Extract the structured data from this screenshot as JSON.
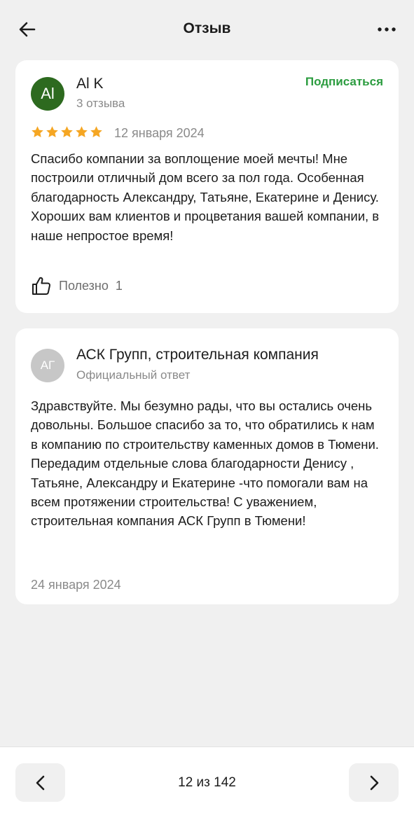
{
  "header": {
    "title": "Отзыв",
    "back_icon": "arrow-left-icon",
    "more_icon": "more-horizontal-icon"
  },
  "review": {
    "avatar_initials": "Al",
    "avatar_color": "#2d6a1f",
    "author": "Al K",
    "author_meta": "3 отзыва",
    "subscribe_label": "Подписаться",
    "subscribe_color": "#2b9c3f",
    "rating": 5,
    "rating_max": 5,
    "star_color": "#f5a623",
    "date": "12 января 2024",
    "text": "Спасибо компании за воплощение моей мечты! Мне построили отличный дом всего за пол года. Особенная благодарность Александру, Татьяне, Екатерине и Денису. Хороших вам клиентов и процветания вашей компании, в наше непростое время!",
    "helpful_icon": "thumbs-up-icon",
    "helpful_label": "Полезно",
    "helpful_count": "1"
  },
  "answer": {
    "avatar_initials": "АГ",
    "avatar_color": "#c7c7c7",
    "author": "АСК Групп, строительная компания",
    "author_meta": "Официальный ответ",
    "text": "Здравствуйте. Мы безумно рады, что вы остались очень довольны. Большое спасибо за то, что обратились к нам в компанию по строительству каменных домов в Тюмени. Передадим отдельные слова благодарности Денису , Татьяне, Александру и Екатерине -что помогали вам на всем протяжении строительства! С уважением, строительная компания АСК Групп в Тюмени!",
    "date": "24 января 2024"
  },
  "pager": {
    "prev_icon": "chevron-left-icon",
    "next_icon": "chevron-right-icon",
    "text": "12 из 142"
  }
}
